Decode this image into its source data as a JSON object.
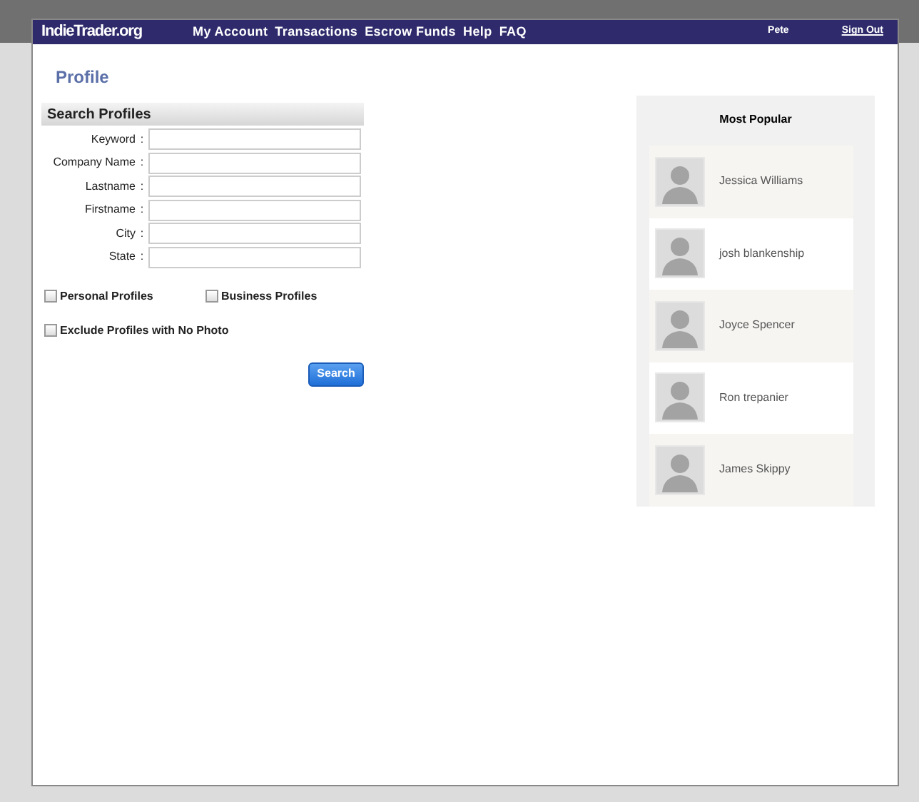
{
  "nav": {
    "logo": "IndieTrader.org",
    "links": [
      "My Account",
      "Transactions",
      "Escrow Funds",
      "Help",
      "FAQ"
    ],
    "user": "Pete",
    "sign_out": "Sign Out"
  },
  "page_title": "Profile",
  "search": {
    "title": "Search Profiles",
    "fields": [
      {
        "label": "Keyword",
        "separator": ":"
      },
      {
        "label": "Company Name",
        "separator": ":"
      },
      {
        "label": "Lastname",
        "separator": ":"
      },
      {
        "label": "Firstname",
        "separator": ":"
      },
      {
        "label": "City",
        "separator": ":"
      },
      {
        "label": "State",
        "separator": ":"
      }
    ],
    "type_options": [
      {
        "label": "Personal Profiles",
        "checked": false
      },
      {
        "label": "Business Profiles",
        "checked": false
      }
    ],
    "exclude_option": {
      "label": "Exclude Profiles with No Photo",
      "checked": false
    },
    "button": "Search"
  },
  "popular": {
    "title": "Most Popular",
    "profiles": [
      {
        "name": "Jessica Williams"
      },
      {
        "name": "josh blankenship"
      },
      {
        "name": "Joyce Spencer"
      },
      {
        "name": "Ron trepanier"
      },
      {
        "name": "James Skippy"
      }
    ]
  }
}
